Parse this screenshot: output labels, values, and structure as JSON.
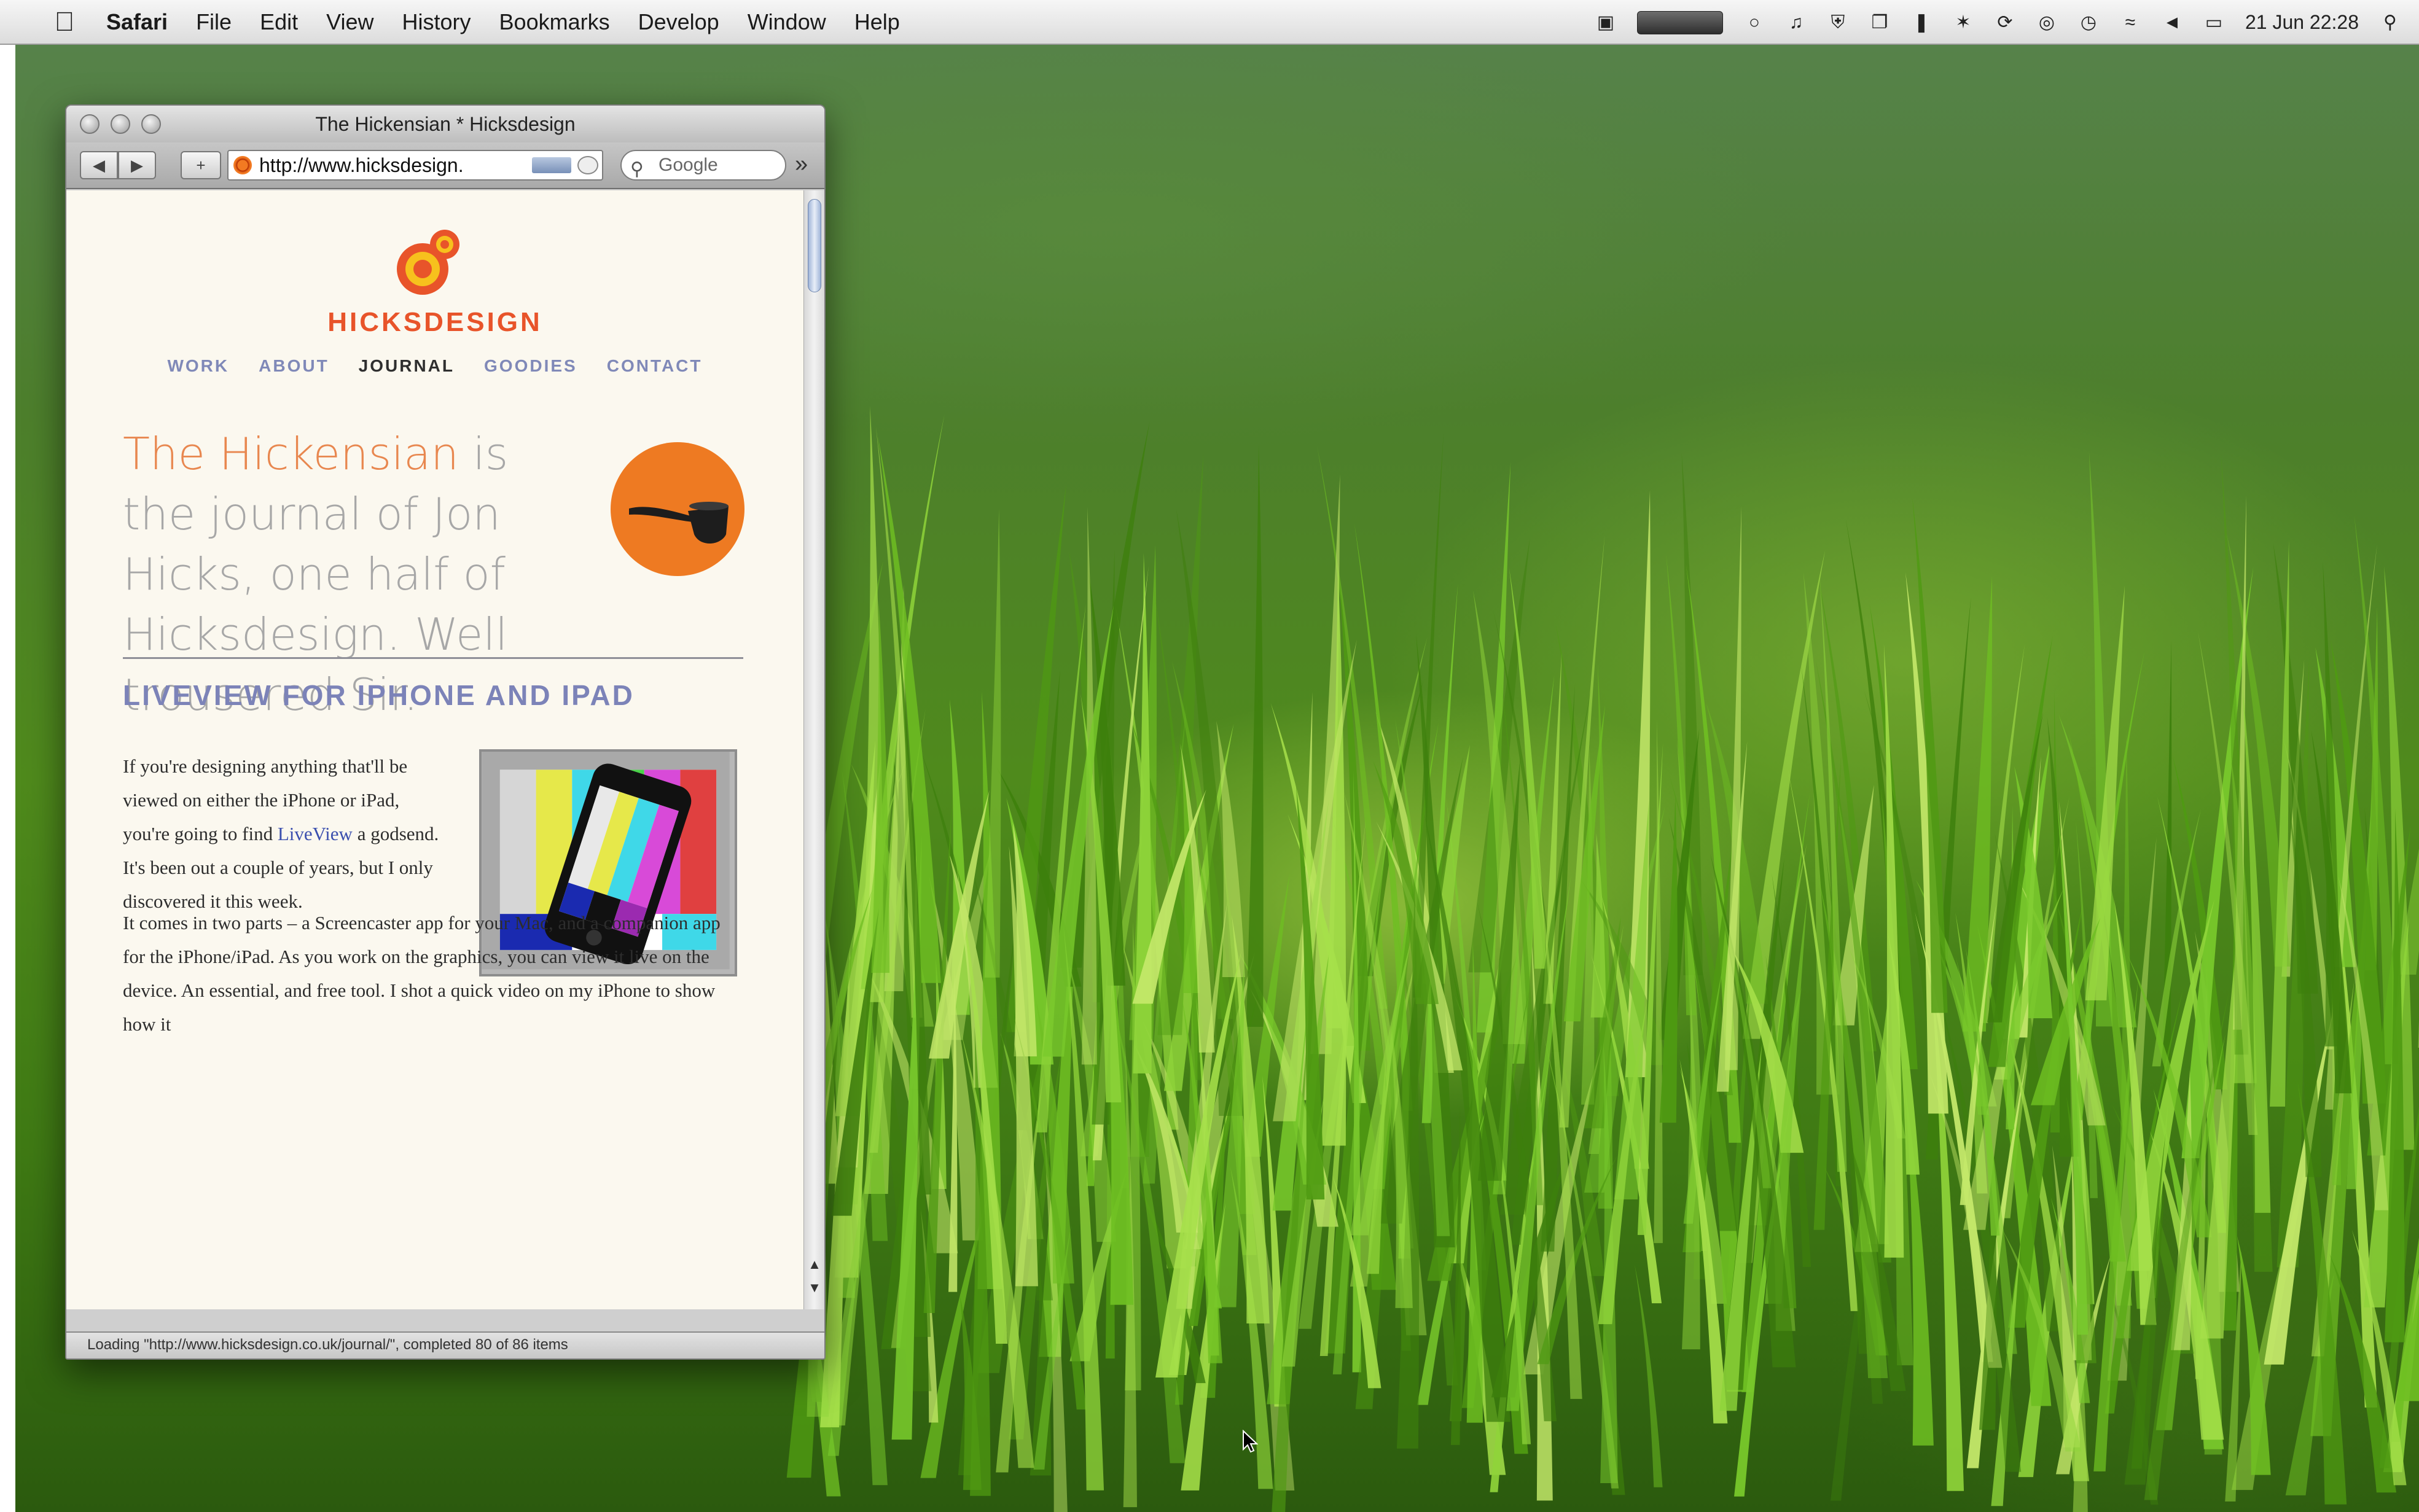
{
  "menubar": {
    "app": "Safari",
    "items": [
      "File",
      "Edit",
      "View",
      "History",
      "Bookmarks",
      "Develop",
      "Window",
      "Help"
    ],
    "clock": "21 Jun  22:28"
  },
  "window": {
    "title": "The Hickensian * Hicksdesign",
    "url": "http://www.hicksdesign.",
    "search_placeholder": "Google",
    "status": "Loading \"http://www.hicksdesign.co.uk/journal/\", completed 80 of 86 items"
  },
  "page": {
    "brand": "HICKSDESIGN",
    "nav": [
      "WORK",
      "ABOUT",
      "JOURNAL",
      "GOODIES",
      "CONTACT"
    ],
    "nav_active_index": 2,
    "intro_highlight": "The Hickensian",
    "intro_rest": " is the journal of Jon Hicks, one half of Hicksdesign. Well trousered Sir.",
    "post_title": "LIVEVIEW FOR IPHONE AND IPAD",
    "para1_before": "If you're designing anything that'll be viewed on either the iPhone or iPad, you're going to find ",
    "para1_link": "LiveView",
    "para1_after": " a godsend. It's been out a couple of years, but I only discovered it this week.",
    "para2": "It comes in two parts – a Screencaster app for your Mac, and a companion app for the iPhone/iPad. As you work on the graphics, you can view it live on the device. An essential, and free tool. I shot a quick video on my iPhone to show how it"
  },
  "colors": {
    "brand_orange": "#e8542a",
    "nav_link": "#8089b8",
    "link_blue": "#3b4fae",
    "title_purple": "#7c83b8"
  }
}
